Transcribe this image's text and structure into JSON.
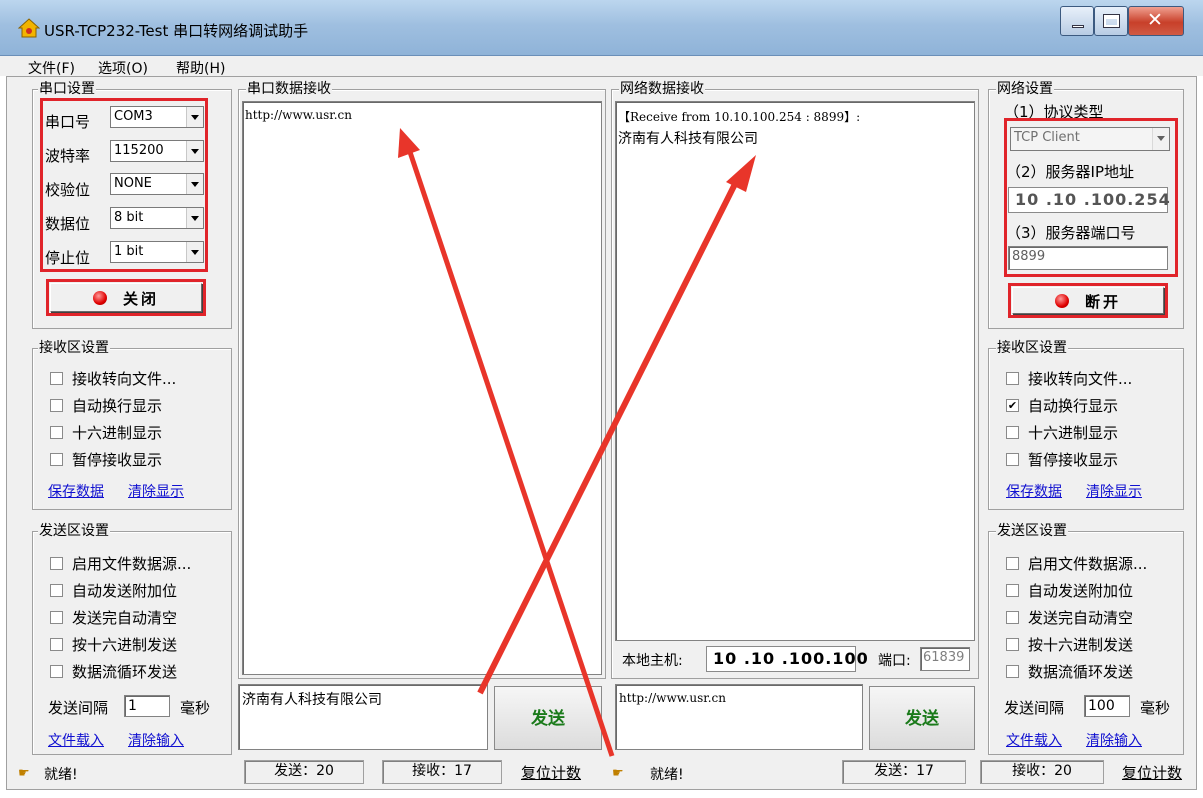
{
  "window": {
    "title": "USR-TCP232-Test 串口转网络调试助手"
  },
  "menu": {
    "items": [
      "文件(F)",
      "选项(O)",
      "帮助(H)"
    ]
  },
  "serial_settings": {
    "title": "串口设置",
    "port_label": "串口号",
    "port_value": "COM3",
    "baud_label": "波特率",
    "baud_value": "115200",
    "parity_label": "校验位",
    "parity_value": "NONE",
    "databits_label": "数据位",
    "databits_value": "8 bit",
    "stopbits_label": "停止位",
    "stopbits_value": "1 bit",
    "close_button": "关闭"
  },
  "left_receive_settings": {
    "title": "接收区设置",
    "options": [
      "接收转向文件...",
      "自动换行显示",
      "十六进制显示",
      "暂停接收显示"
    ],
    "checked": [
      false,
      false,
      false,
      false
    ],
    "save_link": "保存数据",
    "clear_link": "清除显示"
  },
  "left_send_settings": {
    "title": "发送区设置",
    "options": [
      "启用文件数据源...",
      "自动发送附加位",
      "发送完自动清空",
      "按十六进制发送",
      "数据流循环发送"
    ],
    "interval_label": "发送间隔",
    "interval_value": "1",
    "interval_unit": "毫秒",
    "load_link": "文件载入",
    "clear_link": "清除输入"
  },
  "serial_receive": {
    "title": "串口数据接收",
    "content": "http://www.usr.cn"
  },
  "network_receive": {
    "title": "网络数据接收",
    "line1": "【Receive from 10.10.100.254 : 8899】:",
    "line2": "济南有人科技有限公司"
  },
  "local_host": {
    "label": "本地主机:",
    "ip": "10 .10 .100.100",
    "port_label": "端口:",
    "port_value": "61839"
  },
  "serial_send": {
    "content": "济南有人科技有限公司",
    "button": "发送"
  },
  "network_send": {
    "content": "http://www.usr.cn",
    "button": "发送"
  },
  "network_settings": {
    "title": "网络设置",
    "protocol_label": "（1）协议类型",
    "protocol_value": "TCP Client",
    "ip_label": "（2）服务器IP地址",
    "ip_value": "10 .10 .100.254",
    "port_label": "（3）服务器端口号",
    "port_value": "8899",
    "disconnect_button": "断开"
  },
  "right_receive_settings": {
    "title": "接收区设置",
    "options": [
      "接收转向文件...",
      "自动换行显示",
      "十六进制显示",
      "暂停接收显示"
    ],
    "checked": [
      false,
      true,
      false,
      false
    ],
    "save_link": "保存数据",
    "clear_link": "清除显示"
  },
  "right_send_settings": {
    "title": "发送区设置",
    "options": [
      "启用文件数据源...",
      "自动发送附加位",
      "发送完自动清空",
      "按十六进制发送",
      "数据流循环发送"
    ],
    "interval_label": "发送间隔",
    "interval_value": "100",
    "interval_unit": "毫秒",
    "load_link": "文件载入",
    "clear_link": "清除输入"
  },
  "status_left": {
    "ready": "就绪!",
    "sent": "发送：20",
    "received": "接收：17",
    "reset": "复位计数"
  },
  "status_right": {
    "ready": "就绪!",
    "sent": "发送：17",
    "received": "接收：20",
    "reset": "复位计数"
  },
  "colors": {
    "annotation_red": "#e0242a",
    "send_green": "#1a7a1a",
    "link_blue": "#1010d0"
  },
  "icons": [
    "app-icon",
    "minimize-icon",
    "maximize-icon",
    "close-icon",
    "led-icon",
    "status-hand-icon"
  ]
}
